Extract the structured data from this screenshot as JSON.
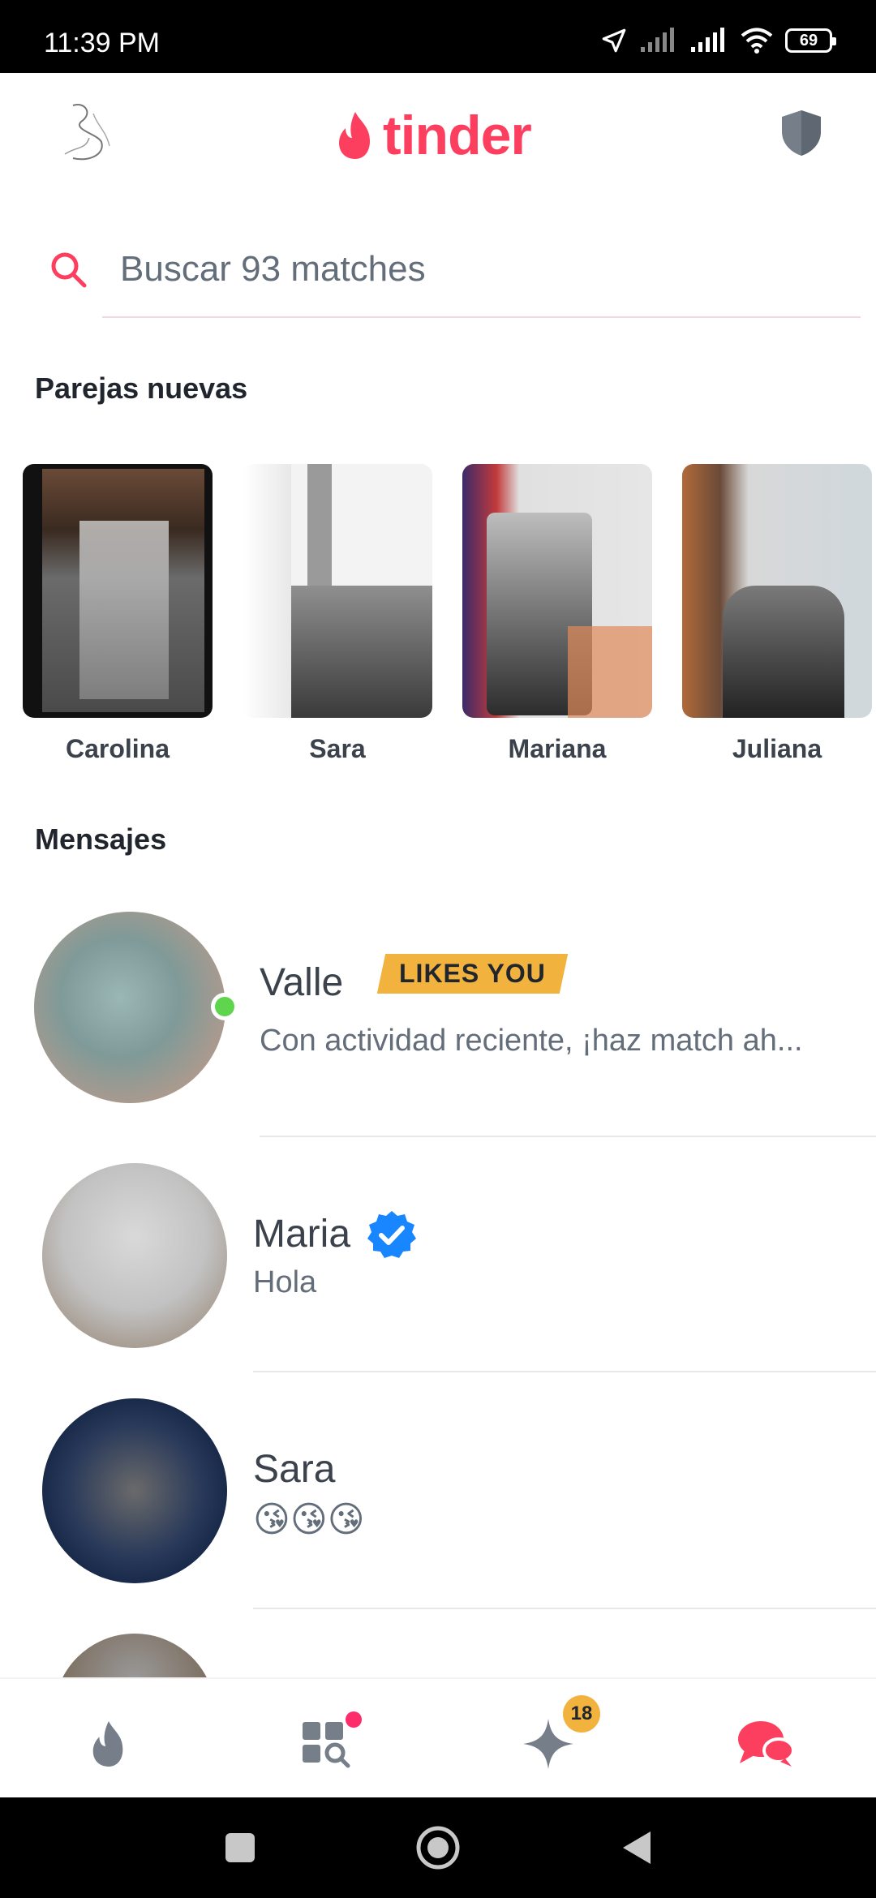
{
  "status_bar": {
    "time": "11:39 PM",
    "battery": "69"
  },
  "header": {
    "logo_text": "tinder"
  },
  "search": {
    "placeholder": "Buscar 93 matches"
  },
  "new_matches": {
    "title": "Parejas nuevas",
    "items": [
      {
        "name": "Carolina"
      },
      {
        "name": "Sara"
      },
      {
        "name": "Mariana"
      },
      {
        "name": "Juliana"
      }
    ]
  },
  "messages": {
    "title": "Mensajes",
    "items": [
      {
        "name": "Valle",
        "badge": "LIKES YOU",
        "preview": "Con actividad reciente, ¡haz match ah...",
        "online": true
      },
      {
        "name": "Maria",
        "verified": true,
        "preview": "Hola"
      },
      {
        "name": "Sara",
        "preview": "😘😘😘"
      }
    ]
  },
  "bottom_nav": {
    "tabs": [
      "home",
      "explore",
      "likes",
      "messages"
    ],
    "likes_count": "18"
  },
  "colors": {
    "brand": "#fd3f5f",
    "badge": "#f2b23e",
    "online": "#5fd54e",
    "verified": "#1786ff"
  }
}
